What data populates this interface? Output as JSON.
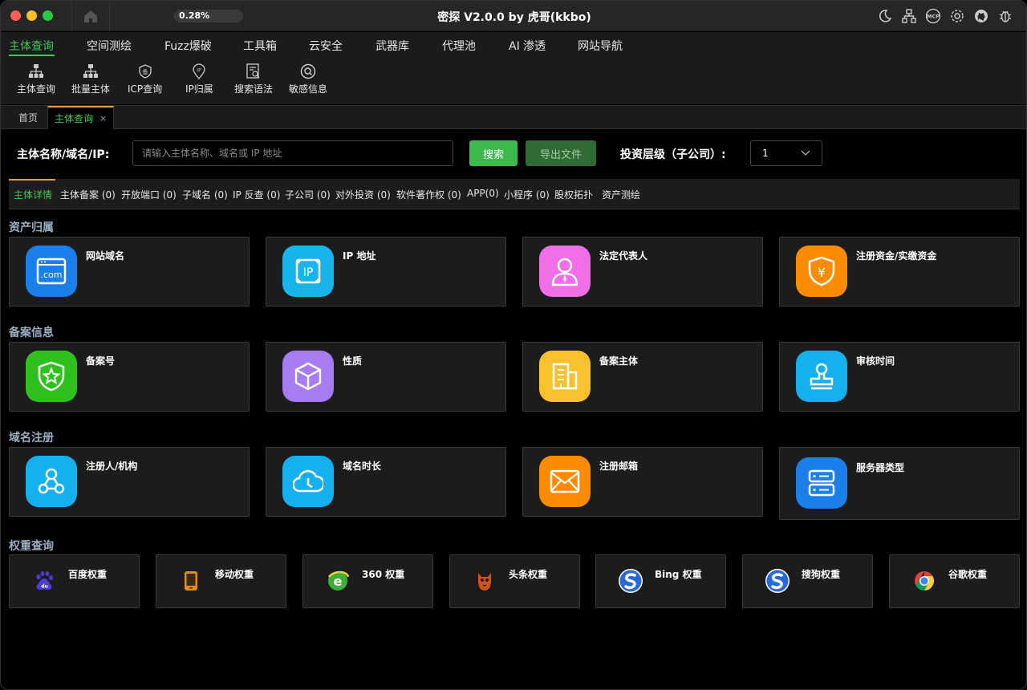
{
  "window": {
    "title": "密探 V2.0.0 by 虎哥(kkbo)",
    "progress_text": "0.28%",
    "progress_value": 0.0028
  },
  "menu": [
    "主体查询",
    "空间测绘",
    "Fuzz爆破",
    "工具箱",
    "云安全",
    "武器库",
    "代理池",
    "AI 渗透",
    "网站导航"
  ],
  "toolbar": [
    "主体查询",
    "批量主体",
    "ICP查询",
    "IP归属",
    "搜索语法",
    "敏感信息"
  ],
  "tabs": {
    "home": "首页",
    "active": "主体查询",
    "close": "×"
  },
  "search": {
    "label": "主体名称/域名/IP:",
    "placeholder": "请输入主体名称、域名或 IP 地址",
    "search_btn": "搜索",
    "export_btn": "导出文件",
    "invest_label": "投资层级（子公司）:",
    "invest_value": "1"
  },
  "subtabs": [
    "主体详情",
    "主体备案 (0)",
    "开放端口 (0)",
    "子域名 (0)",
    "IP 反查 (0)",
    "子公司 (0)",
    "对外投资 (0)",
    "软件著作权 (0)",
    "APP(0)",
    "小程序 (0)",
    "股权拓扑",
    "资产测绘"
  ],
  "sections": [
    {
      "title": "资产归属",
      "cards": [
        {
          "label": "网站域名",
          "icon": "domain-icon",
          "color": "#1a7fe8"
        },
        {
          "label": "IP 地址",
          "icon": "ip-icon",
          "color": "#19b4ec"
        },
        {
          "label": "法定代表人",
          "icon": "person-icon",
          "color": "#f06ee8"
        },
        {
          "label": "注册资金/实缴资金",
          "icon": "money-shield-icon",
          "color": "#fb8c00"
        }
      ]
    },
    {
      "title": "备案信息",
      "cards": [
        {
          "label": "备案号",
          "icon": "shield-star-icon",
          "color": "#2ec11e"
        },
        {
          "label": "性质",
          "icon": "cube-icon",
          "color": "#a77bf2"
        },
        {
          "label": "备案主体",
          "icon": "building-icon",
          "color": "#fbc02d"
        },
        {
          "label": "审核时间",
          "icon": "stamp-icon",
          "color": "#16b0ee"
        }
      ]
    },
    {
      "title": "域名注册",
      "cards": [
        {
          "label": "注册人/机构",
          "icon": "share-icon",
          "color": "#16b0ee"
        },
        {
          "label": "域名时长",
          "icon": "clock-cloud-icon",
          "color": "#16b0ee"
        },
        {
          "label": "注册邮箱",
          "icon": "mail-icon",
          "color": "#fb8c00"
        },
        {
          "label": "服务器类型",
          "icon": "server-icon",
          "color": "#1a7fe8"
        }
      ]
    }
  ],
  "weights": {
    "title": "权重查询",
    "items": [
      {
        "label": "百度权重",
        "icon": "baidu-icon"
      },
      {
        "label": "移动权重",
        "icon": "mobile-icon"
      },
      {
        "label": "360 权重",
        "icon": "360-icon"
      },
      {
        "label": "头条权重",
        "icon": "toutiao-icon"
      },
      {
        "label": "Bing 权重",
        "icon": "bing-icon"
      },
      {
        "label": "搜狗权重",
        "icon": "sogou-icon"
      },
      {
        "label": "谷歌权重",
        "icon": "google-icon"
      }
    ]
  },
  "colors": {
    "accent": "#3fc858",
    "tab_indicator": "#e0a040",
    "section_title": "#9ab0c4"
  }
}
